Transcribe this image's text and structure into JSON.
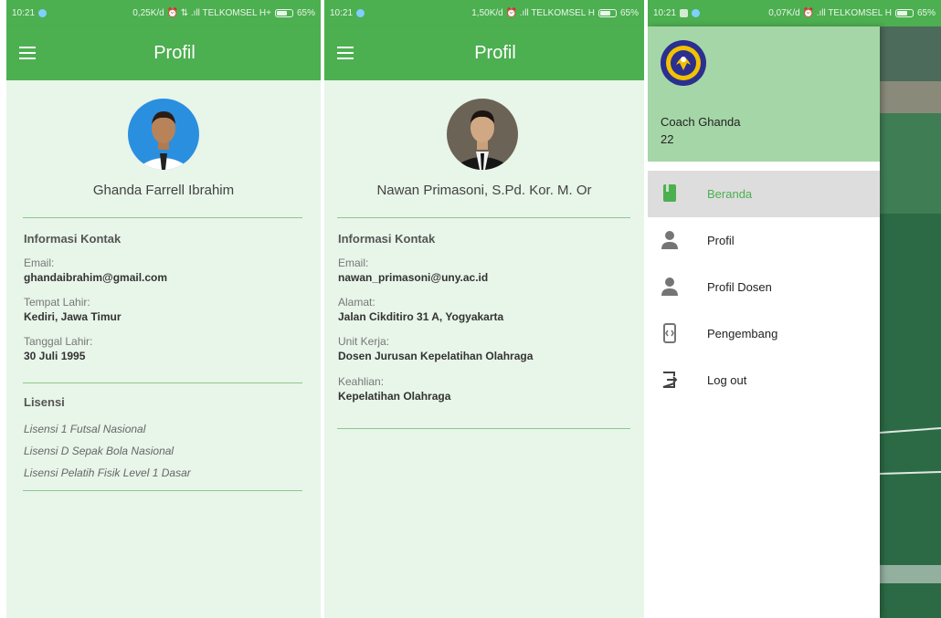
{
  "screens": [
    {
      "status": {
        "time": "10:21",
        "right": "0,25K/d ⏰ ⇅ .ıll TELKOMSEL H+",
        "battery": "65%"
      },
      "title": "Profil",
      "name": "Ghanda Farrell Ibrahim",
      "section1": "Informasi Kontak",
      "fields": [
        {
          "label": "Email:",
          "value": "ghandaibrahim@gmail.com"
        },
        {
          "label": "Tempat Lahir:",
          "value": "Kediri, Jawa Timur"
        },
        {
          "label": "Tanggal Lahir:",
          "value": "30 Juli 1995"
        }
      ],
      "section2": "Lisensi",
      "licenses": [
        "Lisensi 1 Futsal Nasional",
        "Lisensi D Sepak Bola Nasional",
        "Lisensi Pelatih Fisik Level 1 Dasar"
      ]
    },
    {
      "status": {
        "time": "10:21",
        "right": "1,50K/d ⏰ .ıll TELKOMSEL H",
        "battery": "65%"
      },
      "title": "Profil",
      "name": "Nawan Primasoni, S.Pd. Kor. M. Or",
      "section1": "Informasi Kontak",
      "fields": [
        {
          "label": "Email:",
          "value": "nawan_primasoni@uny.ac.id"
        },
        {
          "label": "Alamat:",
          "value": "Jalan Cikditiro 31 A, Yogyakarta"
        },
        {
          "label": "Unit Kerja:",
          "value": "Dosen Jurusan Kepelatihan Olahraga"
        },
        {
          "label": "Keahlian:",
          "value": "Kepelatihan Olahraga"
        }
      ]
    },
    {
      "status": {
        "time": "10:21",
        "right": "0,07K/d ⏰ .ıll TELKOMSEL H",
        "battery": "65%"
      },
      "drawer": {
        "user": "Coach Ghanda",
        "number": "22",
        "items": [
          {
            "label": "Beranda",
            "icon": "book-icon"
          },
          {
            "label": "Profil",
            "icon": "person-icon"
          },
          {
            "label": "Profil Dosen",
            "icon": "person-icon"
          },
          {
            "label": "Pengembang",
            "icon": "developer-icon"
          },
          {
            "label": "Log out",
            "icon": "logout-icon"
          }
        ]
      }
    }
  ],
  "colors": {
    "primary": "#4caf50",
    "background": "#e8f5e9",
    "drawer_header": "#a5d6a7",
    "active_item": "#dddddd"
  }
}
